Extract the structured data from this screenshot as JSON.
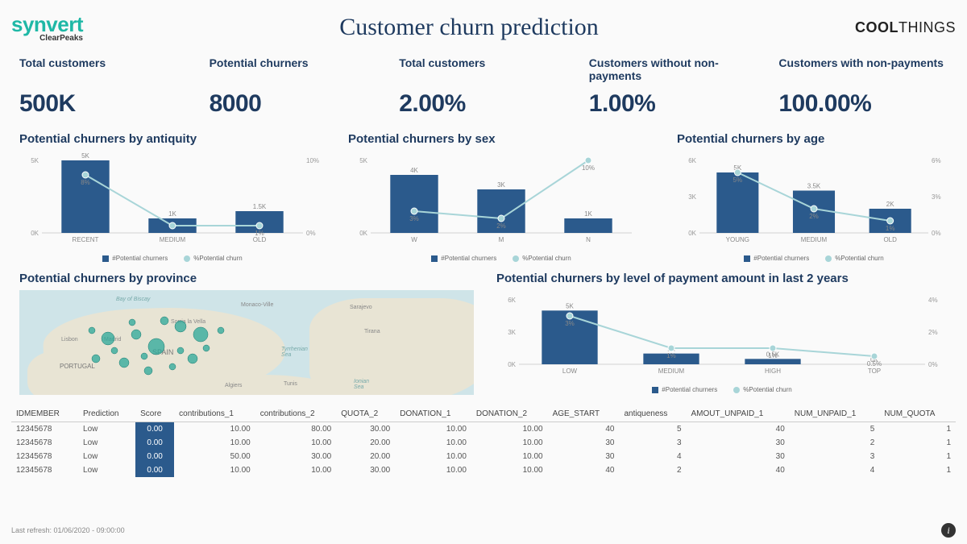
{
  "header": {
    "logo_main": "synvert",
    "logo_sub": "ClearPeaks",
    "title": "Customer churn prediction",
    "brand_bold": "COOL",
    "brand_rest": "THINGS"
  },
  "kpis": [
    {
      "label": "Total customers",
      "value": "500K"
    },
    {
      "label": "Potential churners",
      "value": "8000"
    },
    {
      "label": "Total customers",
      "value": "2.00%"
    },
    {
      "label": "Customers without non-payments",
      "value": "1.00%"
    },
    {
      "label": "Customers with non-payments",
      "value": "100.00%"
    }
  ],
  "legends": {
    "bar": "#Potential churners",
    "line": "%Potential churn"
  },
  "charts": {
    "antiquity": {
      "title": "Potential churners by antiquity"
    },
    "sex": {
      "title": "Potential churners by sex"
    },
    "age": {
      "title": "Potential churners by age"
    },
    "province": {
      "title": "Potential churners by province"
    },
    "payment": {
      "title": "Potential churners by level of payment amount in last 2 years"
    }
  },
  "chart_data": [
    {
      "id": "antiquity",
      "type": "bar+line",
      "categories": [
        "RECENT",
        "MEDIUM",
        "OLD"
      ],
      "bar": {
        "values": [
          5000,
          1000,
          1500
        ],
        "labels": [
          "5K",
          "1K",
          "1.5K"
        ],
        "ylim": [
          0,
          5000
        ],
        "yticks": [
          "0K",
          "5K"
        ]
      },
      "line": {
        "values": [
          8,
          1,
          1
        ],
        "labels": [
          "8%",
          "",
          "1%"
        ],
        "ylim": [
          0,
          10
        ],
        "yticks": [
          "0%",
          "10%"
        ]
      }
    },
    {
      "id": "sex",
      "type": "bar+line",
      "categories": [
        "W",
        "M",
        "N"
      ],
      "bar": {
        "values": [
          4000,
          3000,
          1000
        ],
        "labels": [
          "4K",
          "3K",
          "1K"
        ],
        "ylim": [
          0,
          5000
        ],
        "yticks": [
          "0K",
          "5K"
        ]
      },
      "line": {
        "values": [
          3,
          2,
          10
        ],
        "labels": [
          "3%",
          "2%",
          "10%"
        ],
        "ylim": [
          0,
          10
        ],
        "yticks": [
          "",
          ""
        ]
      }
    },
    {
      "id": "age",
      "type": "bar+line",
      "categories": [
        "YOUNG",
        "MEDIUM",
        "OLD"
      ],
      "bar": {
        "values": [
          5000,
          3500,
          2000
        ],
        "labels": [
          "5K",
          "3.5K",
          "2K"
        ],
        "ylim": [
          0,
          6000
        ],
        "yticks": [
          "0K",
          "3K",
          "6K"
        ]
      },
      "line": {
        "values": [
          5,
          2,
          1
        ],
        "labels": [
          "5%",
          "2%",
          "1%"
        ],
        "ylim": [
          0,
          6
        ],
        "yticks": [
          "0%",
          "3%",
          "6%"
        ]
      }
    },
    {
      "id": "payment",
      "type": "bar+line",
      "categories": [
        "LOW",
        "MEDIUM",
        "HIGH",
        "TOP"
      ],
      "bar": {
        "values": [
          5000,
          1000,
          500,
          0
        ],
        "labels": [
          "5K",
          "1K",
          "0.5K",
          "0K"
        ],
        "ylim": [
          0,
          6000
        ],
        "yticks": [
          "0K",
          "3K",
          "6K"
        ]
      },
      "line": {
        "values": [
          3,
          1,
          1,
          0.5
        ],
        "labels": [
          "3%",
          "1%",
          "1%",
          "0.5%"
        ],
        "ylim": [
          0,
          4
        ],
        "yticks": [
          "0%",
          "2%",
          "4%"
        ]
      }
    }
  ],
  "table": {
    "columns": [
      "IDMEMBER",
      "Prediction",
      "Score",
      "contributions_1",
      "contributions_2",
      "QUOTA_2",
      "DONATION_1",
      "DONATION_2",
      "AGE_START",
      "antiqueness",
      "AMOUT_UNPAID_1",
      "NUM_UNPAID_1",
      "NUM_QUOTA"
    ],
    "rows": [
      [
        "12345678",
        "Low",
        "0.00",
        "10.00",
        "80.00",
        "30.00",
        "10.00",
        "10.00",
        "40",
        "5",
        "40",
        "5",
        "1"
      ],
      [
        "12345678",
        "Low",
        "0.00",
        "10.00",
        "10.00",
        "20.00",
        "10.00",
        "10.00",
        "30",
        "3",
        "30",
        "2",
        "1"
      ],
      [
        "12345678",
        "Low",
        "0.00",
        "50.00",
        "30.00",
        "20.00",
        "10.00",
        "10.00",
        "30",
        "4",
        "30",
        "3",
        "1"
      ],
      [
        "12345678",
        "Low",
        "0.00",
        "10.00",
        "10.00",
        "30.00",
        "10.00",
        "10.00",
        "40",
        "2",
        "40",
        "4",
        "1"
      ]
    ]
  },
  "footer": {
    "refresh": "Last refresh: 01/06/2020 - 09:00:00"
  }
}
